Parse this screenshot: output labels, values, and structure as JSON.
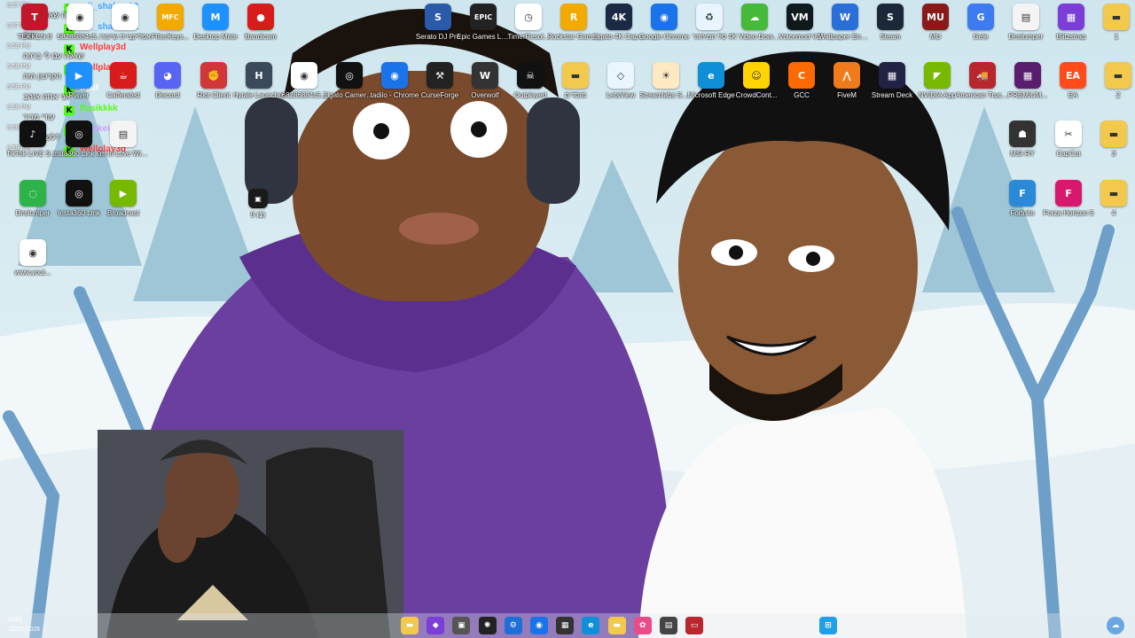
{
  "desktop": {
    "icons_row1": [
      {
        "label": "Serato DJ Pro",
        "icon": "serato-icon",
        "color": "#2b5aa8",
        "glyph": "S"
      },
      {
        "label": "Epic Games Launcher",
        "icon": "epic-games-icon",
        "color": "#222222",
        "glyph": "EPIC"
      },
      {
        "label": "TimerResol...",
        "icon": "clock-icon",
        "color": "#ffffff",
        "glyph": "◷"
      },
      {
        "label": "Rockstar Games ...",
        "icon": "rockstar-icon",
        "color": "#f2a900",
        "glyph": "R"
      },
      {
        "label": "Elgato 4K Captur...",
        "icon": "elgato-4k-icon",
        "color": "#1a2a44",
        "glyph": "4K"
      },
      {
        "label": "Google Chrome",
        "icon": "chrome-icon",
        "color": "#1a73e8",
        "glyph": "◉"
      },
      {
        "label": "סל המיחזור",
        "icon": "recycle-bin-icon",
        "color": "#e8f4ff",
        "glyph": "♻"
      },
      {
        "label": "4K Video Downloader+",
        "icon": "cloud-download-icon",
        "color": "#46b83a",
        "glyph": "☁"
      },
      {
        "label": "Voicemod V3",
        "icon": "voicemod-icon",
        "color": "#0f1a1f",
        "glyph": "VM"
      },
      {
        "label": "Wallpaper Engine",
        "icon": "wallpaper-engine-icon",
        "color": "#2a6fd8",
        "glyph": "W"
      },
      {
        "label": "Steam",
        "icon": "steam-icon",
        "color": "#1b2838",
        "glyph": "S"
      },
      {
        "label": "MU",
        "icon": "mu-icon",
        "color": "#8a1a1a",
        "glyph": "MU"
      },
      {
        "label": "Gele",
        "icon": "g-icon",
        "color": "#3d7bf0",
        "glyph": "G"
      },
      {
        "label": "Dnslumper",
        "icon": "file-icon",
        "color": "#f4f4f4",
        "glyph": "▤"
      },
      {
        "label": "Blitzstrap",
        "icon": "blitzstrap-icon",
        "color": "#7b3fd8",
        "glyph": "▦"
      },
      {
        "label": "1",
        "icon": "folder-icon",
        "color": "#f2c94c",
        "glyph": "▬"
      }
    ],
    "icons_row0_left": [
      {
        "label": "TEKKEN 8",
        "icon": "tekken-icon",
        "color": "#c0182a",
        "glyph": "T"
      },
      {
        "label": "68286884c5...",
        "icon": "chrome-file-icon",
        "color": "#ffffff",
        "glyph": "◉"
      },
      {
        "label": "אפליקציית שיעורי",
        "icon": "chrome-file-icon",
        "color": "#ffffff",
        "glyph": "◉"
      },
      {
        "label": "FilterKeys...",
        "icon": "mfc-icon",
        "color": "#f2a900",
        "glyph": "MFC"
      },
      {
        "label": "Desktop Mate",
        "icon": "desktop-mate-icon",
        "color": "#1e90ff",
        "glyph": "M"
      },
      {
        "label": "Bandicam",
        "icon": "bandicam-icon",
        "color": "#d81b1b",
        "glyph": "●"
      }
    ],
    "icons_row2": [
      {
        "label": "Hytale Launcher",
        "icon": "hytale-icon",
        "color": "#3a4a5a",
        "glyph": "H"
      },
      {
        "label": "68286884c5...",
        "icon": "chrome-file-icon",
        "color": "#ffffff",
        "glyph": "◉"
      },
      {
        "label": "Elgato Camera Hub",
        "icon": "camera-icon",
        "color": "#111111",
        "glyph": "◎"
      },
      {
        "label": "tadilo - Chrome",
        "icon": "chrome-icon",
        "color": "#1a73e8",
        "glyph": "◉"
      },
      {
        "label": "CurseForge",
        "icon": "curseforge-icon",
        "color": "#222222",
        "glyph": "⚒"
      },
      {
        "label": "Overwolf",
        "icon": "overwolf-icon",
        "color": "#333333",
        "glyph": "W"
      },
      {
        "label": "Outplayed",
        "icon": "outplayed-icon",
        "color": "#111111",
        "glyph": "☠"
      },
      {
        "label": "מוסדים",
        "icon": "folder-icon",
        "color": "#f2c94c",
        "glyph": "▬"
      },
      {
        "label": "LetsView",
        "icon": "letsview-icon",
        "color": "#eaf6ff",
        "glyph": "◇"
      },
      {
        "label": "Streamlabs SE.Live",
        "icon": "streamlabs-icon",
        "color": "#ffe9c2",
        "glyph": "☀"
      },
      {
        "label": "Microsoft Edge",
        "icon": "edge-icon",
        "color": "#0f8fd8",
        "glyph": "e"
      },
      {
        "label": "CrowdCont...",
        "icon": "crowd-control-icon",
        "color": "#ffd400",
        "glyph": "☺"
      },
      {
        "label": "GCC",
        "icon": "gcc-icon",
        "color": "#ff6a00",
        "glyph": "C"
      },
      {
        "label": "FiveM",
        "icon": "fivem-icon",
        "color": "#f07b1b",
        "glyph": "⋀"
      },
      {
        "label": "Stream Deck",
        "icon": "stream-deck-icon",
        "color": "#222244",
        "glyph": "▦"
      },
      {
        "label": "NVIDIA App",
        "icon": "nvidia-icon",
        "color": "#76b900",
        "glyph": "◤"
      },
      {
        "label": "American Truck Si...",
        "icon": "truck-icon",
        "color": "#b8272d",
        "glyph": "🚚"
      },
      {
        "label": "PREMIUM...",
        "icon": "premium-icon",
        "color": "#5a1d6e",
        "glyph": "▦"
      },
      {
        "label": "EA",
        "icon": "ea-icon",
        "color": "#ff4c1a",
        "glyph": "EA"
      },
      {
        "label": "2",
        "icon": "folder-icon",
        "color": "#f2c94c",
        "glyph": "▬"
      }
    ],
    "icons_right": [
      {
        "label": "MSI RY",
        "icon": "msi-icon",
        "color": "#333333",
        "glyph": "☗"
      },
      {
        "label": "CapCut",
        "icon": "capcut-icon",
        "color": "#ffffff",
        "glyph": "✂"
      },
      {
        "label": "3",
        "icon": "folder-icon",
        "color": "#f2c94c",
        "glyph": "▬"
      },
      {
        "label": "Fortnite",
        "icon": "fortnite-icon",
        "color": "#2a8ad8",
        "glyph": "F"
      },
      {
        "label": "Forza Horizon 5",
        "icon": "forza-icon",
        "color": "#d8186e",
        "glyph": "F"
      },
      {
        "label": "4",
        "icon": "folder-icon",
        "color": "#f2c94c",
        "glyph": "▬"
      }
    ],
    "icons_left_column": [
      {
        "label": "TikTok LIVE Studio",
        "icon": "tiktok-icon",
        "color": "#111111",
        "glyph": "♪"
      },
      {
        "label": "Insta360 Link Controller",
        "icon": "insta360-icon",
        "color": "#111111",
        "glyph": "◎"
      },
      {
        "label": "I'm in Love With Your...",
        "icon": "file-icon",
        "color": "#f4f4f4",
        "glyph": "▤"
      },
      {
        "label": "Dnslumper",
        "icon": "dns-icon",
        "color": "#2db34a",
        "glyph": "◌"
      },
      {
        "label": "Insta360 Link",
        "icon": "insta360-icon",
        "color": "#111111",
        "glyph": "◎"
      },
      {
        "label": "Broadcast",
        "icon": "broadcast-icon",
        "color": "#76b900",
        "glyph": "▶"
      },
      {
        "label": "www.yout...",
        "icon": "chrome-file-icon",
        "color": "#ffffff",
        "glyph": "◉"
      },
      {
        "label": "Player",
        "icon": "player-icon",
        "color": "#1e90ff",
        "glyph": "▶"
      },
      {
        "label": "Cafferated",
        "icon": "cafferated-icon",
        "color": "#d81b1b",
        "glyph": "☕"
      },
      {
        "label": "Discord",
        "icon": "discord-icon",
        "color": "#5865f2",
        "glyph": "◕"
      },
      {
        "label": "Riot Client",
        "icon": "riot-icon",
        "color": "#d13639",
        "glyph": "✊"
      }
    ],
    "small_file": {
      "label": "9 (1)",
      "icon": "video-file-icon"
    }
  },
  "chat": [
    {
      "time": "8:57 PM",
      "user": "adi_shalom12",
      "user_color": "#4da3ff",
      "message": "אני רוצה שאני חושב"
    },
    {
      "time": "8:57 PM",
      "user": "adi_shalom12",
      "user_color": "#4da3ff",
      "message": "יונה"
    },
    {
      "time": "8:58 PM",
      "user": "Wellplay3d",
      "user_color": "#ff3b3b",
      "message": "שאלה עם לי ברכה"
    },
    {
      "time": "8:58 PM",
      "user": "Wellplay3d",
      "user_color": "#ff3b3b",
      "message": "הקרטון הזה"
    },
    {
      "time": "8:58 PM",
      "user": "usuf",
      "user_color": "#ffffff",
      "message": "אני אתה אוהב"
    },
    {
      "time": "8:58 PM",
      "user": "flusikkkk",
      "user_color": "#53fc18",
      "message": "עודי מכיר"
    },
    {
      "time": "8:58 PM",
      "user": "blackeish",
      "user_color": "#d0a0ff",
      "message": "לשלוח לך?"
    },
    {
      "time": "8:58 PM",
      "user": "Wellplay3d",
      "user_color": "#ff3b3b",
      "message": ""
    }
  ],
  "taskbar": {
    "items": [
      "sticky-notes-icon",
      "visual-studio-icon",
      "game-icon",
      "chatgpt-icon",
      "settings-icon",
      "chrome-icon",
      "store-icon",
      "edge-icon",
      "explorer-icon",
      "photos-icon",
      "notepad-icon",
      "truck-icon",
      "start-icon"
    ],
    "date": "22/01/2026",
    "tray_left": "20/01"
  }
}
